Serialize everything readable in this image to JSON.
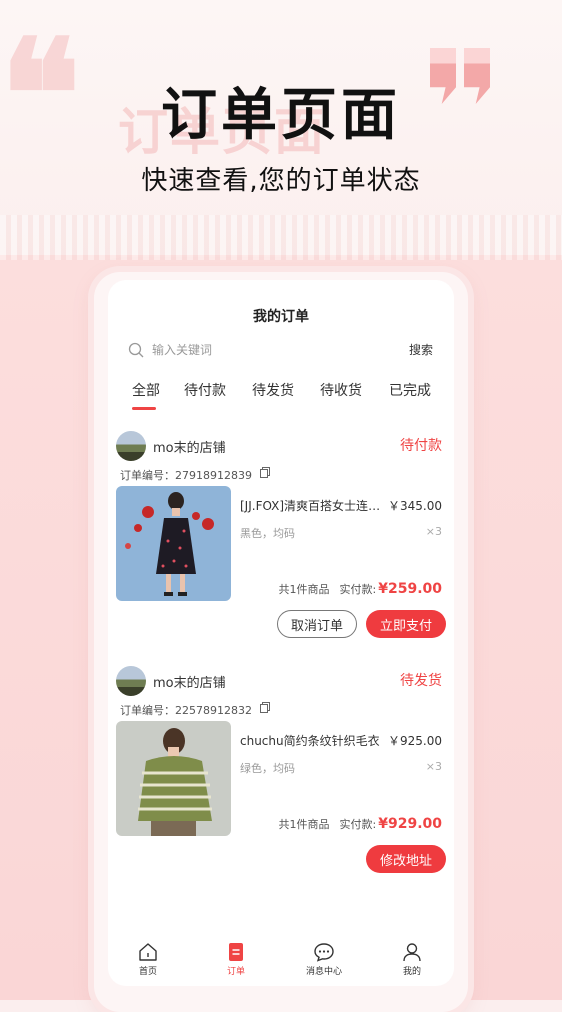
{
  "hero": {
    "ghost_title": "订单页面",
    "title": "订单页面",
    "subtitle": "快速查看,您的订单状态"
  },
  "page": {
    "title": "我的订单"
  },
  "search": {
    "placeholder": "输入关键词",
    "button_label": "搜索"
  },
  "tabs": [
    {
      "label": "全部",
      "active": true
    },
    {
      "label": "待付款",
      "active": false
    },
    {
      "label": "待发货",
      "active": false
    },
    {
      "label": "待收货",
      "active": false
    },
    {
      "label": "已完成",
      "active": false
    }
  ],
  "orders": [
    {
      "shop_name": "mo末的店铺",
      "status": "待付款",
      "order_no_label": "订单编号：",
      "order_no": "27918912839",
      "product_name": "[JJ.FOX]清爽百搭女士连衣裙",
      "product_price": "￥345.00",
      "product_spec": "黑色，均码",
      "quantity": "×3",
      "item_count": "共1件商品",
      "paid_label": "实付款:",
      "paid_amount": "¥259.00",
      "buttons": [
        "取消订单",
        "立即支付"
      ]
    },
    {
      "shop_name": "mo末的店铺",
      "status": "待发货",
      "order_no_label": "订单编号：",
      "order_no": "22578912832",
      "product_name": "chuchu简约条纹针织毛衣",
      "product_price": "￥925.00",
      "product_spec": "绿色，均码",
      "quantity": "×3",
      "item_count": "共1件商品",
      "paid_label": "实付款:",
      "paid_amount": "¥929.00",
      "buttons": [
        "修改地址"
      ]
    }
  ],
  "tabbar": [
    {
      "label": "首页",
      "icon": "home-icon",
      "active": false
    },
    {
      "label": "订单",
      "icon": "order-icon",
      "active": true
    },
    {
      "label": "消息中心",
      "icon": "message-icon",
      "active": false
    },
    {
      "label": "我的",
      "icon": "user-icon",
      "active": false
    }
  ],
  "colors": {
    "accent": "#ef4444",
    "background_pink": "#fcdedd"
  }
}
